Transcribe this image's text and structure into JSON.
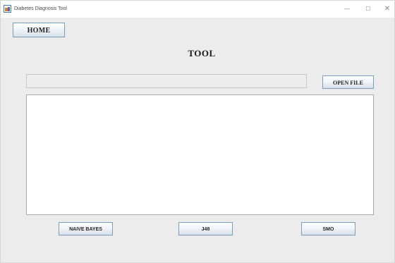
{
  "window": {
    "title": "Diabetes Diagnosis Tool",
    "controls": {
      "minimize_glyph": "—",
      "maximize_glyph": "☐",
      "close_glyph": "✕"
    },
    "icon": "java-app-icon"
  },
  "nav": {
    "home_label": "HOME"
  },
  "main": {
    "title": "TOOL",
    "file_path_value": "",
    "open_file_label": "OPEN FILE",
    "output_text": ""
  },
  "algorithms": {
    "naive_bayes_label": "NAIVE BAYES",
    "j48_label": "J48",
    "smo_label": "SMO"
  }
}
